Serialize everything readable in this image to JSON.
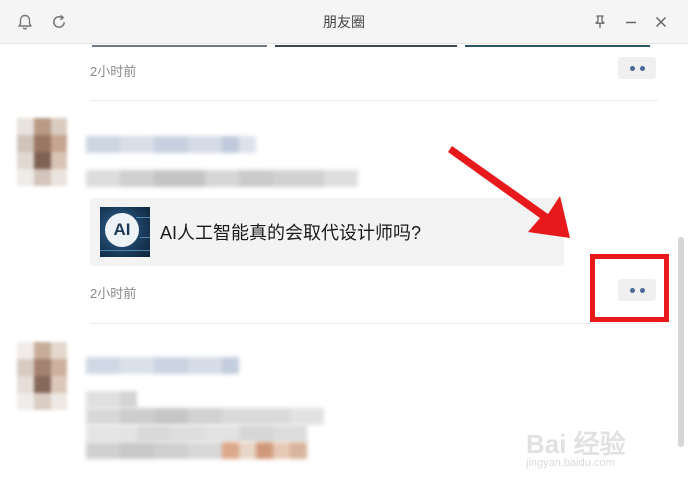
{
  "window": {
    "title": "朋友圈",
    "left_icons": [
      "bell-icon",
      "refresh-icon"
    ],
    "right_icons": [
      "pin-icon",
      "minimize-icon",
      "close-icon"
    ]
  },
  "posts": [
    {
      "time": "2小时前"
    },
    {
      "time": "2小时前",
      "link": {
        "thumb_text": "AI",
        "title": "AI人工智能真的会取代设计师吗?"
      }
    },
    {
      "time": ""
    }
  ],
  "annotation": {
    "arrow_color": "#e8191c",
    "box_color": "#e8191c"
  },
  "watermark": {
    "main": "Bai 经验",
    "sub": "jingyan.baidu.com"
  },
  "colors": {
    "titlebar": "#f5f5f5",
    "card": "#f3f3f3",
    "dots": "#4a6a9a",
    "time": "#8a8a8a"
  }
}
